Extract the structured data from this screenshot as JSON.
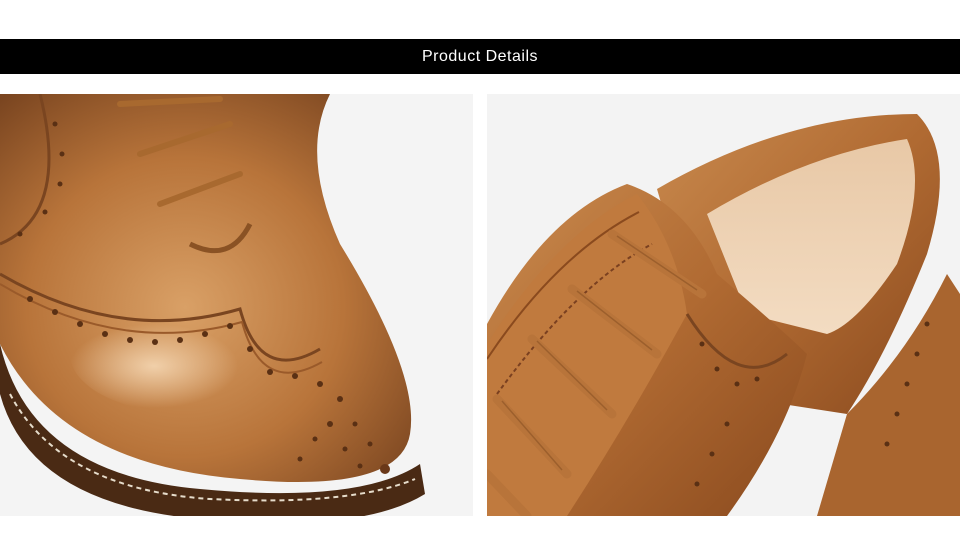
{
  "header": {
    "title": "Product Details"
  },
  "images": [
    {
      "subject": "brogue-toe-closeup-icon"
    },
    {
      "subject": "oxford-laces-closeup-icon"
    }
  ],
  "palette": {
    "leather": "#b8743a",
    "leather_light": "#d9a066",
    "leather_dark": "#7a4520",
    "sole": "#4a2a14",
    "lining": "#e8c8a6",
    "background": "#f4f4f4"
  }
}
